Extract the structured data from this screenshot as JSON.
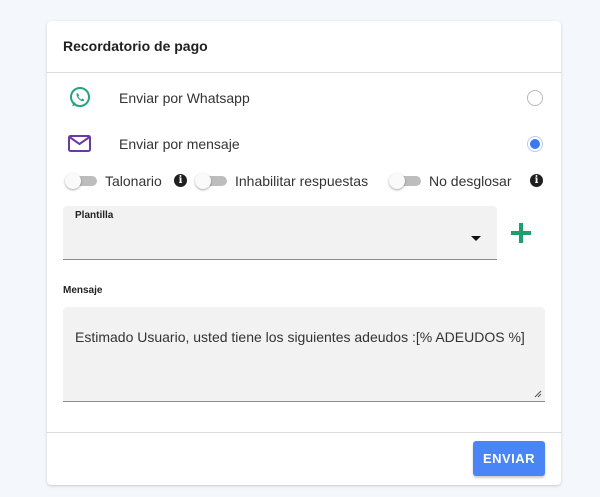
{
  "card": {
    "title": "Recordatorio de pago"
  },
  "options": [
    {
      "label": "Enviar por Whatsapp",
      "icon": "whatsapp-icon",
      "color": "#25a47a",
      "selected": false
    },
    {
      "label": "Enviar por mensaje",
      "icon": "envelope-icon",
      "color": "#6a3aa0",
      "selected": true
    }
  ],
  "toggles": [
    {
      "label": "Talonario",
      "on": false,
      "info": true
    },
    {
      "label": "Inhabilitar respuestas",
      "on": false,
      "info": false
    },
    {
      "label": "No desglosar",
      "on": false,
      "info": true
    }
  ],
  "info_glyph": "i",
  "template_field": {
    "label": "Plantilla",
    "value": ""
  },
  "add_button": {
    "icon": "plus-icon",
    "color": "#1e9e6e"
  },
  "message": {
    "label": "Mensaje",
    "value": "Estimado Usuario, usted tiene los siguientes adeudos :[% ADEUDOS %]"
  },
  "send_button": {
    "label": "ENVIAR",
    "color": "#4a85f7"
  },
  "accent": "#3b78f2"
}
